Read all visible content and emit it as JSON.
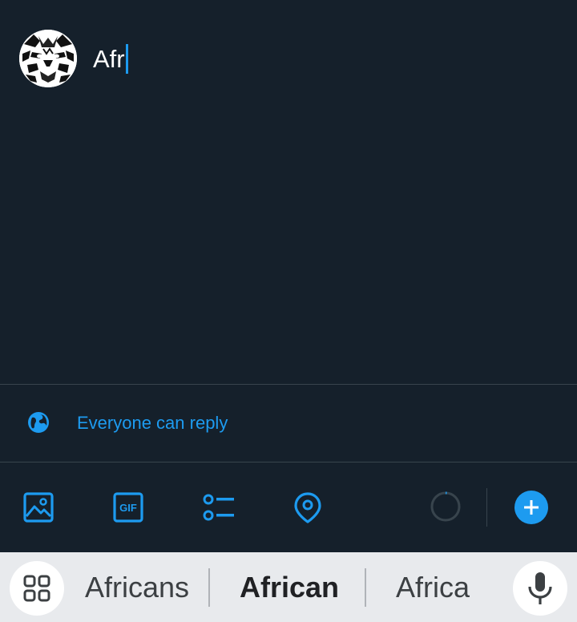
{
  "compose": {
    "text": "Afr",
    "avatar_alt": "tiger-avatar"
  },
  "reply_settings": {
    "label": "Everyone can reply",
    "icon": "globe-icon"
  },
  "toolbar": {
    "tools": [
      "image-icon",
      "gif-icon",
      "poll-icon",
      "location-icon"
    ],
    "gif_label": "GIF",
    "character_progress": 0.0,
    "add_icon": "plus-icon"
  },
  "keyboard": {
    "suggestions": [
      "Africans",
      "African",
      "Africa"
    ],
    "selected_suggestion": "African",
    "left_icon": "apps-grid-icon",
    "right_icon": "microphone-icon"
  },
  "colors": {
    "background": "#15202b",
    "accent": "#1d9bf0",
    "divider": "#38444d",
    "keyboard_bg": "#e8eaed"
  }
}
